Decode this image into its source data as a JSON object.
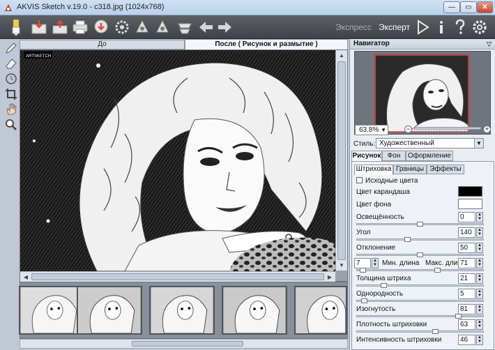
{
  "window": {
    "title": "AKVIS Sketch v.19.0 - c318.jpg (1024x768)",
    "min_glyph": "—",
    "max_glyph": "▭",
    "close_glyph": "✕"
  },
  "toolbar": {
    "mode_express": "Экспресс",
    "mode_expert": "Эксперт",
    "icons": [
      "brush-logo-icon",
      "open-file-icon",
      "save-file-icon",
      "print-icon",
      "share-icon",
      "settings-gear-icon",
      "batch-icon",
      "plugin-icon",
      "presets-icon",
      "undo-arrow-icon",
      "redo-arrow-icon",
      "run-play-icon",
      "info-icon",
      "help-icon",
      "preferences-gear-icon"
    ]
  },
  "tabs": {
    "before": "До",
    "after": "После ( Рисунок и размытие )"
  },
  "navigator": {
    "title": "Навигатор",
    "zoom": "63.8%",
    "zoom_out": "−",
    "zoom_in": "+"
  },
  "style": {
    "label": "Стиль:",
    "value": "Художественный"
  },
  "main_tabs": [
    "Рисунок",
    "Фон",
    "Оформление"
  ],
  "sub_tabs": [
    "Штриховка",
    "Границы",
    "Эффекты"
  ],
  "params": {
    "source_colors": "Исходные цвета",
    "pencil_color": "Цвет карандаша",
    "bg_color": "Цвет фона",
    "pencil_color_hex": "#000000",
    "bg_color_hex": "#ffffff",
    "brightness_label": "Освещённость",
    "brightness": "0",
    "angle_label": "Угол",
    "angle": "140",
    "deviation_label": "Отклонение",
    "deviation": "50",
    "min_len_label": "Мин. длина",
    "min_len": "7",
    "max_len_label": "Макс. длина",
    "max_len": "71",
    "thickness_label": "Толщина штриха",
    "thickness": "21",
    "uniformity_label": "Однородность",
    "uniformity": "5",
    "curvature_label": "Изогнутость",
    "curvature": "81",
    "density_label": "Плотность штриховки",
    "density": "63",
    "intensity_label": "Интенсивность штриховки",
    "intensity": "46"
  },
  "watermark": "ARTSKETCH"
}
